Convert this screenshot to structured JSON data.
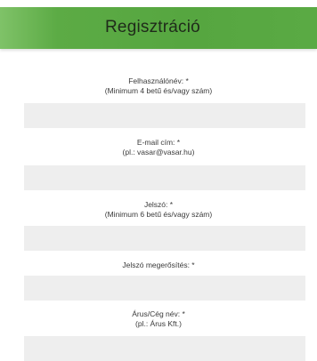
{
  "header": {
    "title": "Regisztráció",
    "bg_color": "#5aaa44"
  },
  "form": {
    "fields": [
      {
        "label": "Felhasználónév: *",
        "hint": "(Minimum 4 betű és/vagy szám)",
        "value": ""
      },
      {
        "label": "E-mail cím: *",
        "hint": "(pl.: vasar@vasar.hu)",
        "value": ""
      },
      {
        "label": "Jelszó: *",
        "hint": "(Minimum 6 betű és/vagy szám)",
        "value": ""
      },
      {
        "label": "Jelszó megerősítés: *",
        "hint": "",
        "value": ""
      },
      {
        "label": "Árus/Cég név: *",
        "hint": "(pl.: Árus Kft.)",
        "value": ""
      }
    ],
    "input_bg_color": "#eeeeee"
  }
}
